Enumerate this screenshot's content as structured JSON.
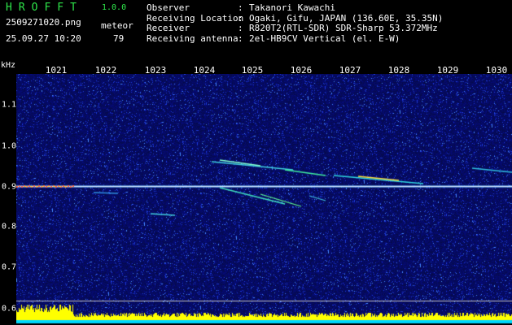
{
  "app": {
    "logo": "HROFFT",
    "version": "1.0.0"
  },
  "file": {
    "name": "2509271020.png",
    "datetime": "25.09.27 10:20"
  },
  "meteor": {
    "label": "meteor",
    "count": "79"
  },
  "info": [
    {
      "key": "Observer",
      "sep": ":",
      "value": "Takanori Kawachi"
    },
    {
      "key": "Receiving Location",
      "sep": ":",
      "value": "Ogaki, Gifu, JAPAN (136.60E, 35.35N)"
    },
    {
      "key": "Receiver",
      "sep": ":",
      "value": "R820T2(RTL-SDR) SDR-Sharp 53.372MHz"
    },
    {
      "key": "Receiving antenna",
      "sep": ":",
      "value": "2el-HB9CV Vertical (el. E-W)"
    }
  ],
  "axis": {
    "unit": "kHz",
    "time_ticks": [
      "1021",
      "1022",
      "1023",
      "1024",
      "1025",
      "1026",
      "1027",
      "1028",
      "1029",
      "1030"
    ],
    "freq_ticks": [
      "1.1",
      "1.0",
      "0.9",
      "0.8",
      "0.7",
      "0.6"
    ]
  },
  "colors": {
    "logo": "#2ee64a",
    "background": "#000000",
    "noise": "#1a2bd0",
    "carrier": "#dfe8ff",
    "bar_yellow": "#ffff00",
    "bar_cyan": "#00d8ff"
  }
}
